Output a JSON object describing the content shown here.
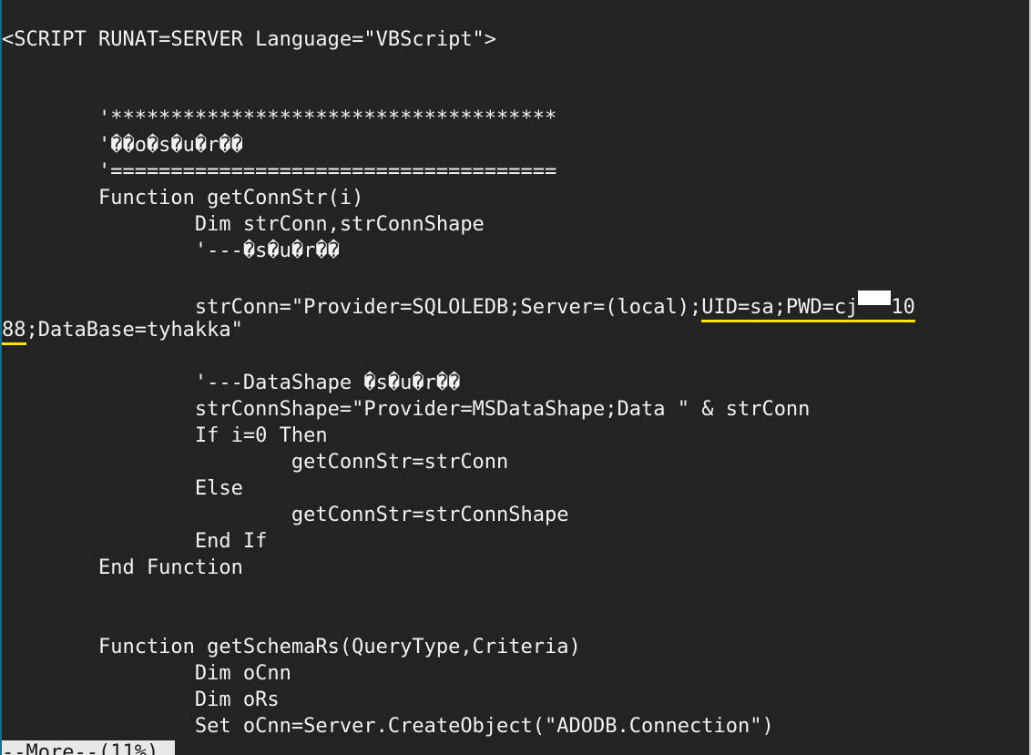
{
  "terminal": {
    "lines": [
      "<SCRIPT RUNAT=SERVER Language=\"VBScript\">",
      "",
      "",
      "        '*************************************",
      "        '��o�s�u�r��",
      "        '=====================================",
      "        Function getConnStr(i)",
      "                Dim strConn,strConnShape",
      "                '---�s�u�r��",
      "",
      "",
      "",
      "",
      "                '---DataShape �s�u�r��",
      "                strConnShape=\"Provider=MSDataShape;Data \" & strConn",
      "                If i=0 Then",
      "                        getConnStr=strConn",
      "                Else",
      "                        getConnStr=strConnShape",
      "                End If",
      "        End Function",
      "",
      "",
      "        Function getSchemaRs(QueryType,Criteria)",
      "                Dim oCnn",
      "                Dim oRs",
      "                Set oCnn=Server.CreateObject(\"ADODB.Connection\")"
    ],
    "conn_line": {
      "prefix": "                strConn=\"Provider=SQLOLEDB;Server=(local);",
      "highlighted_start": "UID=sa;PWD=cj",
      "highlighted_after_redaction": "10"
    },
    "wrap_line": {
      "highlighted": "88",
      "rest": ";DataBase=tyhakka\""
    },
    "pager_status": "--More--(11%)"
  }
}
